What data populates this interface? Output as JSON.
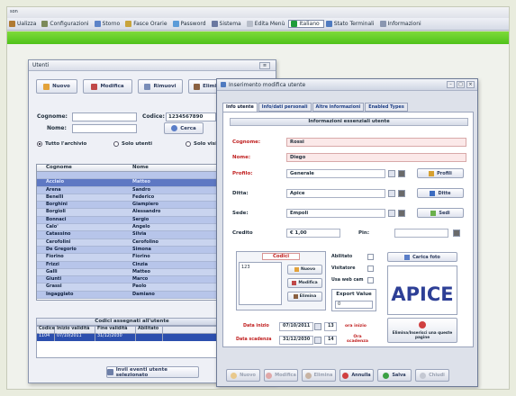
{
  "app": {
    "title_fragment": "son"
  },
  "menu": [
    {
      "label": "Ualizza",
      "icon": "list-icon",
      "color": "#b07a32"
    },
    {
      "label": "Configurazioni",
      "icon": "config-icon",
      "color": "#7c8a5a"
    },
    {
      "label": "Storno",
      "icon": "undo-icon",
      "color": "#5c83c8"
    },
    {
      "label": "Fasce Orarie",
      "icon": "clock-icon",
      "color": "#c8a43c"
    },
    {
      "label": "Password",
      "icon": "key-icon",
      "color": "#5c9cd8"
    },
    {
      "label": "Sistema",
      "icon": "system-icon",
      "color": "#6a78a0"
    },
    {
      "label": "Edita Menù",
      "icon": "edit-menu-icon",
      "color": "#b7bdc9"
    },
    {
      "label": "Italiano",
      "icon": "italian-flag-icon",
      "color": "#1f9c3a",
      "selected": true
    },
    {
      "label": "Stato Terminali",
      "icon": "terminal-icon",
      "color": "#4f7ac0"
    },
    {
      "label": "Informazioni",
      "icon": "info-icon",
      "color": "#8a96b0"
    }
  ],
  "utenti": {
    "title": "Utenti",
    "toolbar": {
      "nuovo": "Nuovo",
      "modifica": "Modifica",
      "rimuovi": "Rimuovi",
      "elimina": "Elimina"
    },
    "cognome_label": "Cognome:",
    "codice_label": "Codice:",
    "codice_value": "1234567890",
    "nome_label": "Nome:",
    "cerca": "Cerca",
    "radio": {
      "tutto": "Tutto l'archivio",
      "solo_utenti": "Solo utenti",
      "solo_visit": "Solo visit"
    },
    "columns": {
      "cognome": "Cognome",
      "nome": "Nome"
    },
    "rows": [
      {
        "cognome": "",
        "nome": ""
      },
      {
        "cognome": "Acciaio",
        "nome": "Matteo"
      },
      {
        "cognome": "Arena",
        "nome": "Sandro"
      },
      {
        "cognome": "Benelli",
        "nome": "Federico"
      },
      {
        "cognome": "Borghini",
        "nome": "Giampiero"
      },
      {
        "cognome": "Borgioli",
        "nome": "Alessandro"
      },
      {
        "cognome": "Bonnaci",
        "nome": "Sergio"
      },
      {
        "cognome": "Calo'",
        "nome": "Angelo"
      },
      {
        "cognome": "Catassino",
        "nome": "Silvia"
      },
      {
        "cognome": "Cerofolini",
        "nome": "Cerofolino"
      },
      {
        "cognome": "De Gregorio",
        "nome": "Simona"
      },
      {
        "cognome": "Fiorino",
        "nome": "Fiorino"
      },
      {
        "cognome": "Frizzi",
        "nome": "Cinzia"
      },
      {
        "cognome": "Galli",
        "nome": "Matteo"
      },
      {
        "cognome": "Giunti",
        "nome": "Marco"
      },
      {
        "cognome": "Grassi",
        "nome": "Paolo"
      },
      {
        "cognome": "Ingaggiato",
        "nome": "Damiano"
      }
    ],
    "codici_title": "Codici assegnati all'utente",
    "codici_columns": [
      "Codice",
      "Inizio validità",
      "Fine validità",
      "Abilitato"
    ],
    "codici_rows": [
      [
        "1104",
        "07/10/2011",
        "31/12/2030",
        ""
      ]
    ],
    "bottom_button": "Invii eventi utente selezionato"
  },
  "form": {
    "title": "Inserimento modifica utente",
    "tabs": [
      "Info utente",
      "Info/dati personali",
      "Altre informazioni",
      "Enabled Types"
    ],
    "section_title": "Informazioni essenziali utente",
    "cognome": {
      "label": "Cognome:",
      "value": "Rossi"
    },
    "nome": {
      "label": "Nome:",
      "value": "Diego"
    },
    "profilo": {
      "label": "Profilo:",
      "value": "Generale",
      "button": "Profili"
    },
    "ditta": {
      "label": "Ditta:",
      "value": "Apice",
      "button": "Ditte"
    },
    "sede": {
      "label": "Sede:",
      "value": "Empoli",
      "button": "Sedi"
    },
    "credito": {
      "label": "Credito",
      "value": "€ 1,00"
    },
    "pin": {
      "label": "Pin:",
      "value": ""
    },
    "codici": {
      "title": "Codici",
      "value": "123",
      "nuovo": "Nuovo",
      "modifica": "Modifica",
      "elimina": "Elimina"
    },
    "checks": {
      "abilitato": "Abilitato",
      "visitatore": "Visitatore",
      "usa_web_cam": "Usa web cam"
    },
    "export": {
      "title": "Export Value",
      "value": "0"
    },
    "foto_button": "Carica foto",
    "logo_text": "APICE",
    "elimina_foto": "Elimina/Inserisci una queste pagine",
    "data_inizio": {
      "label": "Data inizio",
      "date": "07/10/2011",
      "hour": "13",
      "hour_label": "ora inizio"
    },
    "data_scadenza": {
      "label": "Data scadenza",
      "date": "31/12/2030",
      "hour": "14",
      "hour_label": "Ora scadenza"
    },
    "footer": {
      "nuovo": "Nuovo",
      "modifica": "Modifica",
      "elimina": "Elimina",
      "annulla": "Annulla",
      "salva": "Salva",
      "chiudi": "Chiudi"
    }
  }
}
